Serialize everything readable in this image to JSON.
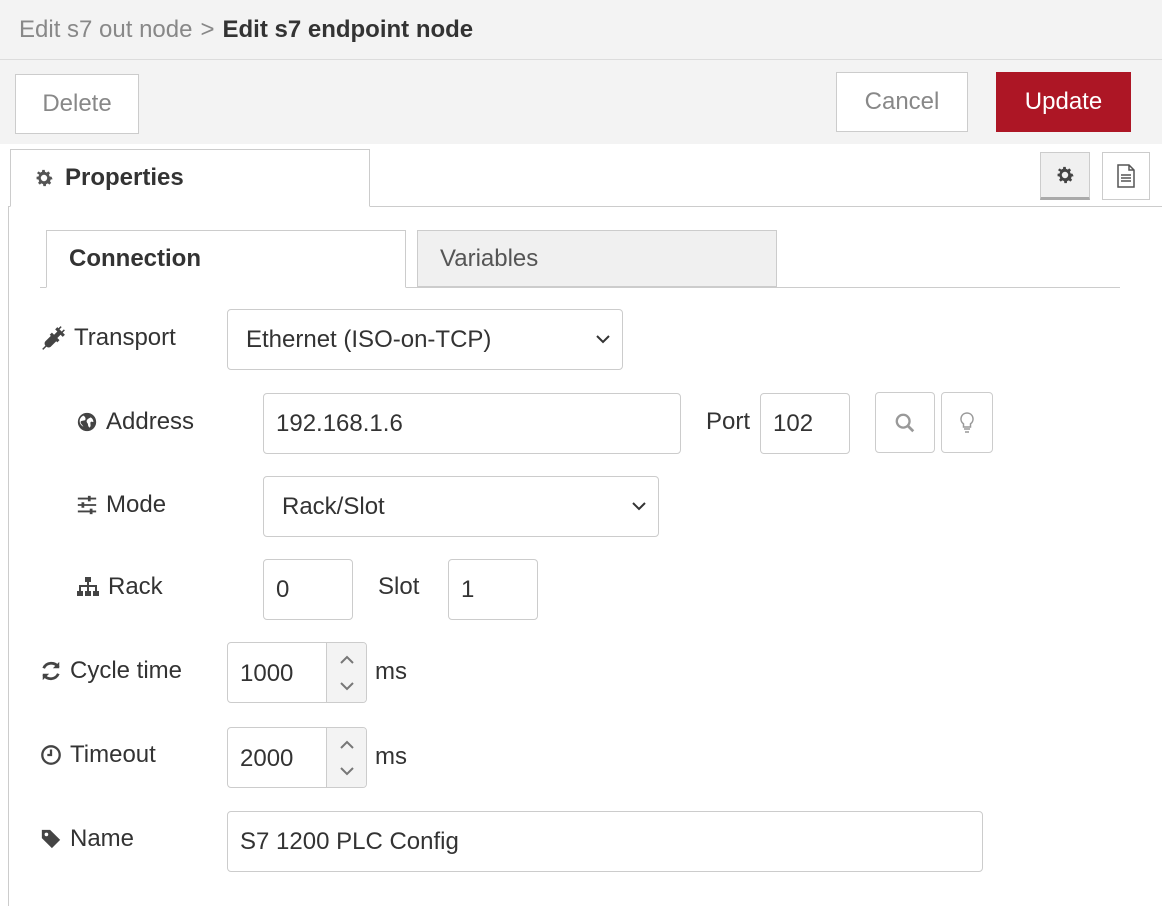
{
  "header": {
    "breadcrumb_parent": "Edit s7 out node",
    "separator": ">",
    "title": "Edit s7 endpoint node"
  },
  "toolbar": {
    "delete_label": "Delete",
    "cancel_label": "Cancel",
    "update_label": "Update"
  },
  "tabs": {
    "properties_label": "Properties"
  },
  "subtabs": {
    "connection_label": "Connection",
    "variables_label": "Variables"
  },
  "form": {
    "transport_label": "Transport",
    "transport_value": "Ethernet (ISO-on-TCP)",
    "address_label": "Address",
    "address_value": "192.168.1.6",
    "port_label": "Port",
    "port_value": "102",
    "mode_label": "Mode",
    "mode_value": "Rack/Slot",
    "rack_label": "Rack",
    "rack_value": "0",
    "slot_label": "Slot",
    "slot_value": "1",
    "cycle_label": "Cycle time",
    "cycle_value": "1000",
    "cycle_unit": "ms",
    "timeout_label": "Timeout",
    "timeout_value": "2000",
    "timeout_unit": "ms",
    "name_label": "Name",
    "name_value": "S7 1200 PLC Config"
  },
  "colors": {
    "update_button": "#ad1625",
    "header_bg": "#f3f3f3"
  },
  "icons": [
    "gear-icon",
    "document-icon",
    "plug-icon",
    "globe-icon",
    "sliders-icon",
    "sitemap-icon",
    "search-icon",
    "lightbulb-icon",
    "refresh-icon",
    "clock-icon",
    "tag-icon",
    "chevron-down-icon"
  ]
}
